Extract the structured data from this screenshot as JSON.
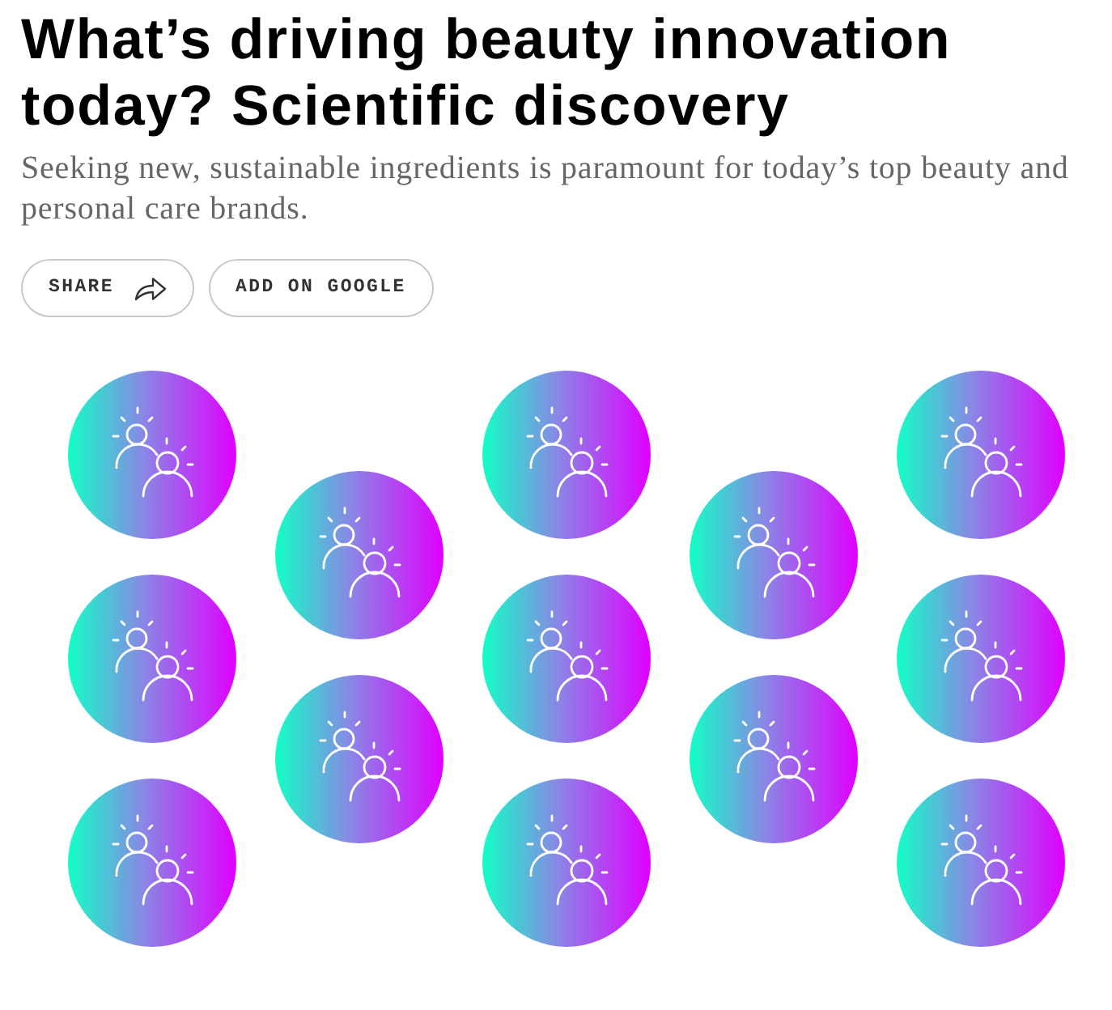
{
  "article": {
    "title": "What’s driving beauty innovation today? Scientific discovery",
    "subtitle": "Seeking new, sustainable ingredients is paramount for today’s top beauty and personal care brands."
  },
  "buttons": [
    {
      "label": "SHARE",
      "kind": "share"
    },
    {
      "label": "ADD ON GOOGLE",
      "kind": "plain"
    }
  ]
}
